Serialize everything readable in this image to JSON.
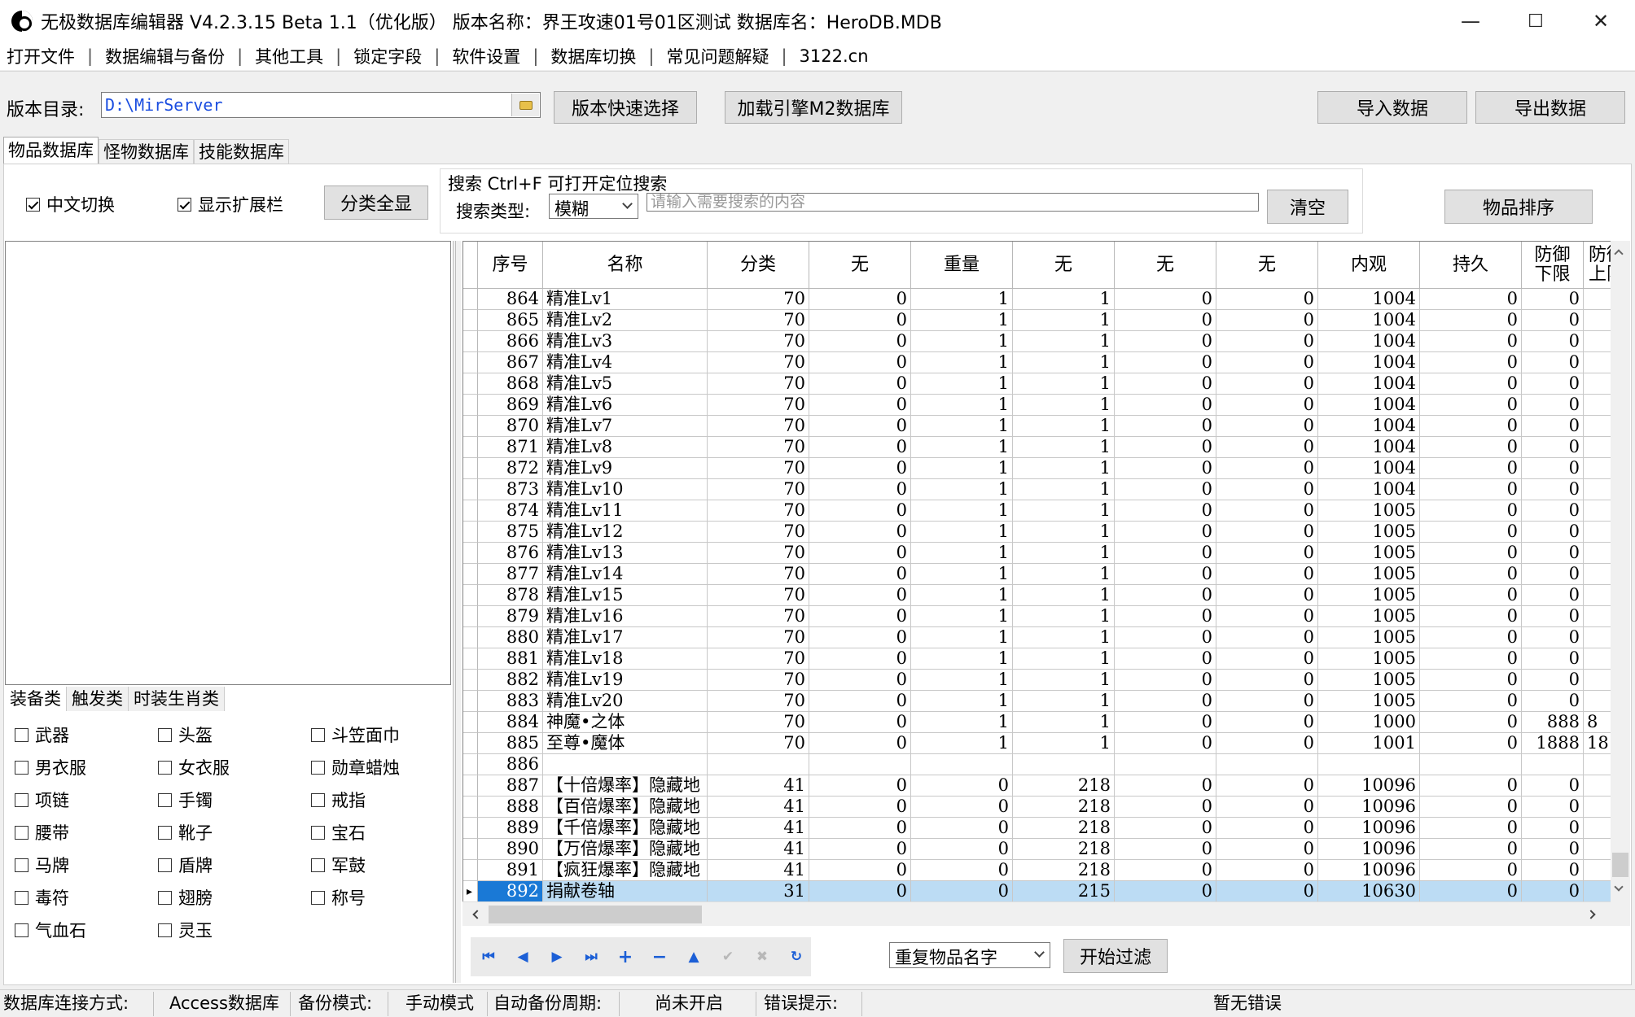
{
  "window": {
    "title": "无极数据库编辑器 V4.2.3.15     Beta 1.1（优化版）     版本名称：界王攻速01号01区测试     数据库名：HeroDB.MDB",
    "minimize": "—",
    "maximize": "☐",
    "close": "✕"
  },
  "menu": [
    "打开文件",
    "数据编辑与备份",
    "其他工具",
    "锁定字段",
    "软件设置",
    "数据库切换",
    "常见问题解疑",
    "3122.cn"
  ],
  "toolbar": {
    "dir_label": "版本目录:",
    "dir_value": "D:\\MirServer",
    "quick_select": "版本快速选择",
    "load_m2": "加载引擎M2数据库",
    "import": "导入数据",
    "export": "导出数据"
  },
  "tabs": [
    "物品数据库",
    "怪物数据库",
    "技能数据库"
  ],
  "options": {
    "chinese_switch": "中文切换",
    "show_ext": "显示扩展栏",
    "show_all": "分类全显",
    "search_title": "搜索  Ctrl+F 可打开定位搜索",
    "search_type_label": "搜索类型:",
    "search_type_value": "模糊",
    "search_placeholder": "请输入需要搜索的内容",
    "clear": "清空",
    "sort": "物品排序"
  },
  "subtabs": [
    "装备类",
    "触发类",
    "时装生肖类"
  ],
  "categories": [
    "武器",
    "头盔",
    "斗笠面巾",
    "男衣服",
    "女衣服",
    "勋章蜡烛",
    "项链",
    "手镯",
    "戒指",
    "腰带",
    "靴子",
    "宝石",
    "马牌",
    "盾牌",
    "军鼓",
    "毒符",
    "翅膀",
    "称号",
    "气血石",
    "灵玉"
  ],
  "grid": {
    "columns": [
      "序号",
      "名称",
      "分类",
      "无",
      "重量",
      "无",
      "无",
      "无",
      "内观",
      "持久",
      "防御\n下限",
      "防御\n上限"
    ],
    "rows": [
      [
        "864",
        "精准Lv1",
        "70",
        "0",
        "1",
        "1",
        "0",
        "0",
        "1004",
        "0",
        "0",
        ""
      ],
      [
        "865",
        "精准Lv2",
        "70",
        "0",
        "1",
        "1",
        "0",
        "0",
        "1004",
        "0",
        "0",
        ""
      ],
      [
        "866",
        "精准Lv3",
        "70",
        "0",
        "1",
        "1",
        "0",
        "0",
        "1004",
        "0",
        "0",
        ""
      ],
      [
        "867",
        "精准Lv4",
        "70",
        "0",
        "1",
        "1",
        "0",
        "0",
        "1004",
        "0",
        "0",
        ""
      ],
      [
        "868",
        "精准Lv5",
        "70",
        "0",
        "1",
        "1",
        "0",
        "0",
        "1004",
        "0",
        "0",
        ""
      ],
      [
        "869",
        "精准Lv6",
        "70",
        "0",
        "1",
        "1",
        "0",
        "0",
        "1004",
        "0",
        "0",
        ""
      ],
      [
        "870",
        "精准Lv7",
        "70",
        "0",
        "1",
        "1",
        "0",
        "0",
        "1004",
        "0",
        "0",
        ""
      ],
      [
        "871",
        "精准Lv8",
        "70",
        "0",
        "1",
        "1",
        "0",
        "0",
        "1004",
        "0",
        "0",
        ""
      ],
      [
        "872",
        "精准Lv9",
        "70",
        "0",
        "1",
        "1",
        "0",
        "0",
        "1004",
        "0",
        "0",
        ""
      ],
      [
        "873",
        "精准Lv10",
        "70",
        "0",
        "1",
        "1",
        "0",
        "0",
        "1004",
        "0",
        "0",
        ""
      ],
      [
        "874",
        "精准Lv11",
        "70",
        "0",
        "1",
        "1",
        "0",
        "0",
        "1005",
        "0",
        "0",
        ""
      ],
      [
        "875",
        "精准Lv12",
        "70",
        "0",
        "1",
        "1",
        "0",
        "0",
        "1005",
        "0",
        "0",
        ""
      ],
      [
        "876",
        "精准Lv13",
        "70",
        "0",
        "1",
        "1",
        "0",
        "0",
        "1005",
        "0",
        "0",
        ""
      ],
      [
        "877",
        "精准Lv14",
        "70",
        "0",
        "1",
        "1",
        "0",
        "0",
        "1005",
        "0",
        "0",
        ""
      ],
      [
        "878",
        "精准Lv15",
        "70",
        "0",
        "1",
        "1",
        "0",
        "0",
        "1005",
        "0",
        "0",
        ""
      ],
      [
        "879",
        "精准Lv16",
        "70",
        "0",
        "1",
        "1",
        "0",
        "0",
        "1005",
        "0",
        "0",
        ""
      ],
      [
        "880",
        "精准Lv17",
        "70",
        "0",
        "1",
        "1",
        "0",
        "0",
        "1005",
        "0",
        "0",
        ""
      ],
      [
        "881",
        "精准Lv18",
        "70",
        "0",
        "1",
        "1",
        "0",
        "0",
        "1005",
        "0",
        "0",
        ""
      ],
      [
        "882",
        "精准Lv19",
        "70",
        "0",
        "1",
        "1",
        "0",
        "0",
        "1005",
        "0",
        "0",
        ""
      ],
      [
        "883",
        "精准Lv20",
        "70",
        "0",
        "1",
        "1",
        "0",
        "0",
        "1005",
        "0",
        "0",
        ""
      ],
      [
        "884",
        "神魔•之体",
        "70",
        "0",
        "1",
        "1",
        "0",
        "0",
        "1000",
        "0",
        "888",
        "8"
      ],
      [
        "885",
        "至尊•魔体",
        "70",
        "0",
        "1",
        "1",
        "0",
        "0",
        "1001",
        "0",
        "1888",
        "18"
      ],
      [
        "886",
        "",
        "",
        "",
        "",
        "",
        "",
        "",
        "",
        "",
        "",
        ""
      ],
      [
        "887",
        "【十倍爆率】隐藏地",
        "41",
        "0",
        "0",
        "218",
        "0",
        "0",
        "10096",
        "0",
        "0",
        ""
      ],
      [
        "888",
        "【百倍爆率】隐藏地",
        "41",
        "0",
        "0",
        "218",
        "0",
        "0",
        "10096",
        "0",
        "0",
        ""
      ],
      [
        "889",
        "【千倍爆率】隐藏地",
        "41",
        "0",
        "0",
        "218",
        "0",
        "0",
        "10096",
        "0",
        "0",
        ""
      ],
      [
        "890",
        "【万倍爆率】隐藏地",
        "41",
        "0",
        "0",
        "218",
        "0",
        "0",
        "10096",
        "0",
        "0",
        ""
      ],
      [
        "891",
        "【疯狂爆率】隐藏地",
        "41",
        "0",
        "0",
        "218",
        "0",
        "0",
        "10096",
        "0",
        "0",
        ""
      ],
      [
        "892",
        "捐献卷轴",
        "31",
        "0",
        "0",
        "215",
        "0",
        "0",
        "10630",
        "0",
        "0",
        ""
      ]
    ],
    "selected_index": 28
  },
  "filter": {
    "mode_value": "重复物品名字",
    "start": "开始过滤"
  },
  "nav_icons": [
    "first-icon",
    "prev-icon",
    "next-icon",
    "last-icon",
    "add-icon",
    "delete-icon",
    "edit-icon",
    "post-icon",
    "cancel-icon",
    "refresh-icon"
  ],
  "status": {
    "conn_label": "数据库连接方式:",
    "conn_value": "Access数据库",
    "backup_label": "备份模式:",
    "backup_value": "手动模式",
    "auto_label": "自动备份周期:",
    "auto_value": "尚未开启",
    "err_label": "错误提示:",
    "err_value": "暂无错误"
  }
}
